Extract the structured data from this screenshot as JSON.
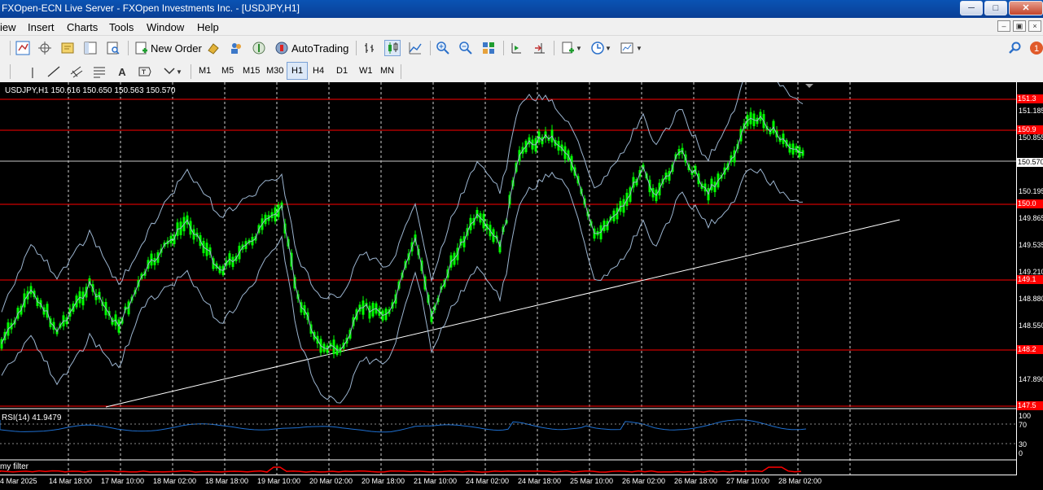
{
  "window": {
    "title": "FXOpen-ECN Live Server - FXOpen Investments Inc. - [USDJPY,H1]"
  },
  "menu": {
    "view": "iew",
    "insert": "Insert",
    "charts": "Charts",
    "tools": "Tools",
    "window": "Window",
    "help": "Help"
  },
  "toolbar": {
    "new_order": "New Order",
    "autotrading": "AutoTrading"
  },
  "timeframes": [
    "M1",
    "M5",
    "M15",
    "M30",
    "H1",
    "H4",
    "D1",
    "W1",
    "MN"
  ],
  "active_timeframe": "H1",
  "chart": {
    "symbol_header": "USDJPY,H1  150.616 150.650 150.563 150.570",
    "rsi_label": "RSI(14) 41.9479",
    "filter_label": "my filter",
    "price_ticks": [
      "151.185",
      "150.855",
      "150.195",
      "149.865",
      "149.535",
      "149.210",
      "148.880",
      "148.550",
      "147.890"
    ],
    "price_tags": {
      "level1": "151.3",
      "level2": "150.9",
      "current": "150.570",
      "level3": "150.0",
      "level4": "149.1",
      "level5": "148.2",
      "level6": "147.5"
    },
    "rsi_ticks": [
      "100",
      "70",
      "30",
      "0"
    ],
    "time_ticks": [
      "4 Mar 2025",
      "14 Mar 18:00",
      "17 Mar 10:00",
      "18 Mar 02:00",
      "18 Mar 18:00",
      "19 Mar 10:00",
      "20 Mar 02:00",
      "20 Mar 18:00",
      "21 Mar 10:00",
      "24 Mar 02:00",
      "24 Mar 18:00",
      "25 Mar 10:00",
      "26 Mar 02:00",
      "26 Mar 18:00",
      "27 Mar 10:00",
      "28 Mar 02:00"
    ],
    "colors": {
      "background": "#000000",
      "candles": "#00ff00",
      "bands": "#9bb4cf",
      "levels": "#ff0000",
      "trendline": "#ffffff",
      "rsi": "#1e6fd0",
      "filter": "#ff0000"
    }
  }
}
